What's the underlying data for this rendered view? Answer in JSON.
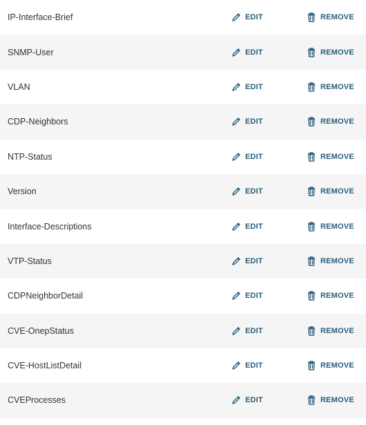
{
  "items": [
    {
      "name": "IP-Interface-Brief",
      "edit_label": "EDIT",
      "remove_label": "REMOVE"
    },
    {
      "name": "SNMP-User",
      "edit_label": "EDIT",
      "remove_label": "REMOVE"
    },
    {
      "name": "VLAN",
      "edit_label": "EDIT",
      "remove_label": "REMOVE"
    },
    {
      "name": "CDP-Neighbors",
      "edit_label": "EDIT",
      "remove_label": "REMOVE"
    },
    {
      "name": "NTP-Status",
      "edit_label": "EDIT",
      "remove_label": "REMOVE"
    },
    {
      "name": "Version",
      "edit_label": "EDIT",
      "remove_label": "REMOVE"
    },
    {
      "name": "Interface-Descriptions",
      "edit_label": "EDIT",
      "remove_label": "REMOVE"
    },
    {
      "name": "VTP-Status",
      "edit_label": "EDIT",
      "remove_label": "REMOVE"
    },
    {
      "name": "CDPNeighborDetail",
      "edit_label": "EDIT",
      "remove_label": "REMOVE"
    },
    {
      "name": "CVE-OnepStatus",
      "edit_label": "EDIT",
      "remove_label": "REMOVE"
    },
    {
      "name": "CVE-HostListDetail",
      "edit_label": "EDIT",
      "remove_label": "REMOVE"
    },
    {
      "name": "CVEProcesses",
      "edit_label": "EDIT",
      "remove_label": "REMOVE"
    }
  ],
  "icons": {
    "edit": "pencil-icon",
    "remove": "trash-icon"
  },
  "colors": {
    "accent": "#2b5d7a",
    "row_odd": "#ffffff",
    "row_even": "#f5f5f5",
    "text": "#333333"
  }
}
